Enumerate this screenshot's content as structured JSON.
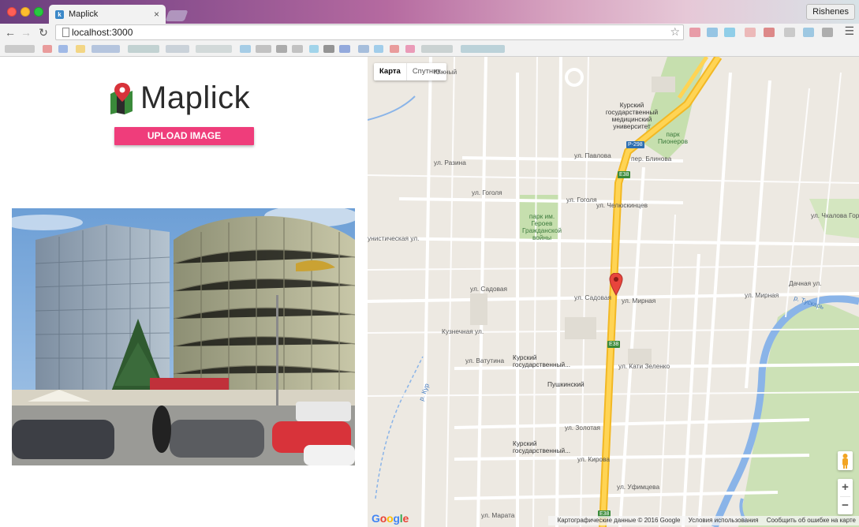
{
  "browser": {
    "tab_title": "Maplick",
    "tab_close": "×",
    "url": "localhost:3000",
    "profile_name": "Rishenes"
  },
  "app": {
    "logo_text": "Maplick",
    "upload_button_label": "UPLOAD IMAGE",
    "accent_color": "#ef3d7b"
  },
  "map": {
    "type_control": {
      "map_label": "Карта",
      "satellite_label": "Спутник"
    },
    "zoom_in": "+",
    "zoom_out": "−",
    "google_logo": "Google",
    "attribution": {
      "data": "Картографические данные © 2016 Google",
      "terms": "Условия использования",
      "report": "Сообщить об ошибке на карте"
    },
    "road_labels": {
      "chelyuskintsev": "ул. Челюскинцев",
      "gogolya_left": "ул. Гоголя",
      "gogolya_right": "ул. Гоголя",
      "razina": "ул. Разина",
      "pavlova": "ул. Павлова",
      "blinova_per": "пер. Блинова",
      "sadovaya_left": "ул. Садовая",
      "sadovaya_right": "ул. Садовая",
      "mirnaya": "ул. Мирная",
      "mirnaya_right": "ул. Мирная",
      "vatutina": "ул. Ватутина",
      "kati_zelenko": "ул. Кати Зеленко",
      "kuznechnaya": "Кузнечная ул.",
      "zolotaya": "ул. Золотая",
      "kirova": "ул. Кирова",
      "ufimtseva": "ул. Уфимцева",
      "marata": "ул. Марата",
      "chkalova": "ул. Чкалова Гора",
      "dachnaya": "Дачная ул.",
      "universitetskaya": "унистическая ул.",
      "yuzhny": "Южный",
      "pushkinsky": "Пушкинский"
    },
    "poi_labels": {
      "medical_university": "Курский государственный медицинский университет",
      "park_pionerov": "парк Пионеров",
      "park_heroes": "парк им. Героев Гражданской войны",
      "kursk_state_1": "Курский государственный...",
      "kursk_state_2": "Курский государственный..."
    },
    "highway_labels": {
      "r298": "Р-298",
      "e38_a": "E38",
      "e38_b": "E38",
      "e38_c": "E38"
    },
    "water_labels": {
      "tuskar": "р. Тускарь",
      "kur": "р. Кур"
    }
  }
}
